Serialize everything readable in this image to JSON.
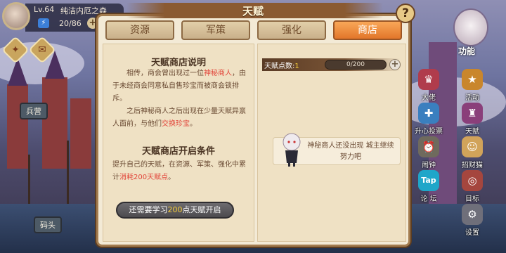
{
  "player": {
    "level": "Lv.64",
    "name": "纯洁内厄之森",
    "energy_current": "20/86",
    "energy_icon": "lightning-icon",
    "plus": "+"
  },
  "map_signs": {
    "barracks": "兵营",
    "dock": "码头"
  },
  "modal": {
    "title": "天赋",
    "help": "?",
    "tabs": [
      {
        "label": "资源",
        "active": false
      },
      {
        "label": "军策",
        "active": false
      },
      {
        "label": "强化",
        "active": false
      },
      {
        "label": "商店",
        "active": true
      }
    ],
    "shop_intro": {
      "title": "天赋商店说明",
      "para1_a": "相传，商会曾出现过一位",
      "para1_hl": "神秘商人",
      "para1_b": "，由于未经商会同意私自售珍宝而被商会锁排斥。",
      "para2_a": "之后神秘商人之后出现在少量天赋异禀人面前，与他们",
      "para2_hl": "交换珍宝",
      "para2_b": "。"
    },
    "open_conditions": {
      "title": "天赋商店开启条件",
      "para_a": "提升自己的天赋，在资源、军策、强化中累计",
      "para_hl": "消耗200天赋点",
      "para_b": "。"
    },
    "learn_button": {
      "prefix": "还需要学习",
      "num": "200",
      "suffix": "点天赋开启"
    },
    "points": {
      "label": "天赋点数:",
      "value": "1",
      "progress_text": "0/200",
      "progress_fraction": 0,
      "plus": "+"
    },
    "merchant_message": "神秘商人还没出现 城主继续努力吧"
  },
  "side_menu": {
    "func_label": "功能",
    "items": [
      {
        "label": "大佬",
        "icon": "crown-icon"
      },
      {
        "label": "活动",
        "icon": "star-badge-icon"
      },
      {
        "label": "升心投票",
        "icon": "vote-icon"
      },
      {
        "label": "天赋",
        "icon": "talent-icon"
      },
      {
        "label": "闹钟",
        "icon": "alarm-clock-icon"
      },
      {
        "label": "招财猫",
        "icon": "lucky-cat-icon"
      },
      {
        "label": "论 坛",
        "icon": "tap-icon"
      },
      {
        "label": "目标",
        "icon": "target-icon"
      },
      {
        "label": "设置",
        "icon": "gear-icon"
      }
    ]
  },
  "colors": {
    "accent_tab": "#e2762a",
    "highlight": "#e2453a",
    "gold": "#f6cd3b"
  }
}
